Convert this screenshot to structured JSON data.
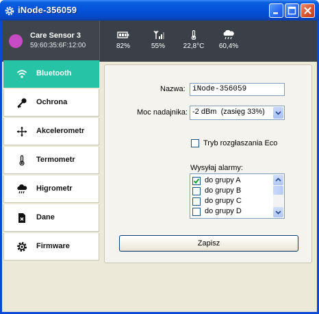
{
  "window": {
    "title": "iNode-356059",
    "icons": {
      "app": "gear-icon",
      "minimize": "minimize-icon",
      "maximize": "maximize-icon",
      "close": "close-icon"
    }
  },
  "device": {
    "name": "Care Sensor 3",
    "mac": "59:60:35:6F:12:00",
    "avatar_color": "#c64bc4"
  },
  "stats": [
    {
      "icon": "battery-icon",
      "value": "82%"
    },
    {
      "icon": "signal-icon",
      "value": "55%"
    },
    {
      "icon": "thermometer-icon",
      "value": "22,8°C"
    },
    {
      "icon": "cloud-rain-icon",
      "value": "60,4%"
    }
  ],
  "sidebar": {
    "accent": "#26c3a6",
    "items": [
      {
        "label": "Bluetooth",
        "icon": "wifi-icon",
        "active": true
      },
      {
        "label": "Ochrona",
        "icon": "key-icon"
      },
      {
        "label": "Akcelerometr",
        "icon": "move-arrows-icon"
      },
      {
        "label": "Termometr",
        "icon": "thermometer-icon"
      },
      {
        "label": "Higrometr",
        "icon": "cloud-rain-icon"
      },
      {
        "label": "Dane",
        "icon": "file-delete-icon"
      },
      {
        "label": "Firmware",
        "icon": "gear-icon"
      }
    ]
  },
  "form": {
    "name_label": "Nazwa:",
    "name_value": "iNode-356059",
    "power_label": "Moc nadajnika:",
    "power_value": "-2 dBm  (zasięg 33%)",
    "eco_label": "Tryb rozgłaszania Eco",
    "eco_checked": false,
    "alarms_label": "Wysyłaj alarmy:",
    "alarm_groups": [
      {
        "label": "do grupy A",
        "checked": true
      },
      {
        "label": "do grupy B",
        "checked": false
      },
      {
        "label": "do grupy C",
        "checked": false
      },
      {
        "label": "do grupy D",
        "checked": false
      }
    ],
    "save_label": "Zapisz"
  }
}
